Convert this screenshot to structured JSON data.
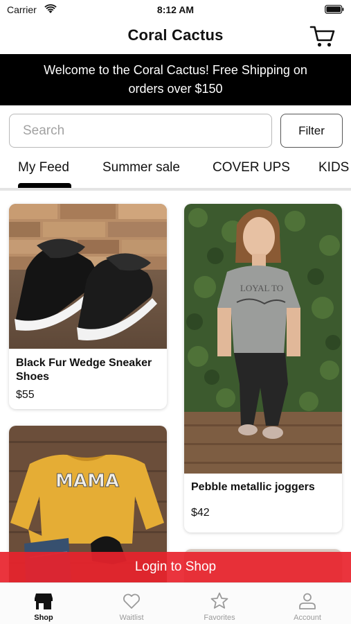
{
  "status_bar": {
    "carrier": "Carrier",
    "time": "8:12 AM"
  },
  "nav": {
    "title": "Coral Cactus",
    "cart_icon": "shopping-cart-icon"
  },
  "banner": {
    "text": "Welcome to the Coral Cactus! Free Shipping on orders over $150"
  },
  "search": {
    "placeholder": "Search",
    "value": ""
  },
  "filter_label": "Filter",
  "tabs": [
    {
      "label": "My Feed",
      "selected": true
    },
    {
      "label": "Summer sale",
      "selected": false
    },
    {
      "label": "COVER UPS",
      "selected": false
    },
    {
      "label": "KIDS",
      "selected": false
    }
  ],
  "products": [
    {
      "name": "Black Fur Wedge Sneaker Shoes",
      "price": "$55",
      "image": "black fur wedge sneakers on wood floor"
    },
    {
      "name": "Pebble metallic joggers",
      "price": "$42",
      "image": "woman in grey tee and black joggers"
    },
    {
      "name": "",
      "price": "",
      "image": "yellow MAMA sweatshirt flat lay"
    },
    {
      "name": "",
      "price": "",
      "image": "partially visible product"
    }
  ],
  "login_bar": {
    "label": "Login to Shop"
  },
  "tab_bar": [
    {
      "label": "Shop",
      "icon": "storefront-icon",
      "active": true
    },
    {
      "label": "Waitlist",
      "icon": "heart-icon",
      "active": false
    },
    {
      "label": "Favorites",
      "icon": "star-icon",
      "active": false
    },
    {
      "label": "Account",
      "icon": "person-icon",
      "active": false
    }
  ],
  "colors": {
    "banner_bg": "#000000",
    "login_bar": "#e8232d",
    "active_tab": "#111111",
    "inactive_tab": "#9a9a9a"
  }
}
